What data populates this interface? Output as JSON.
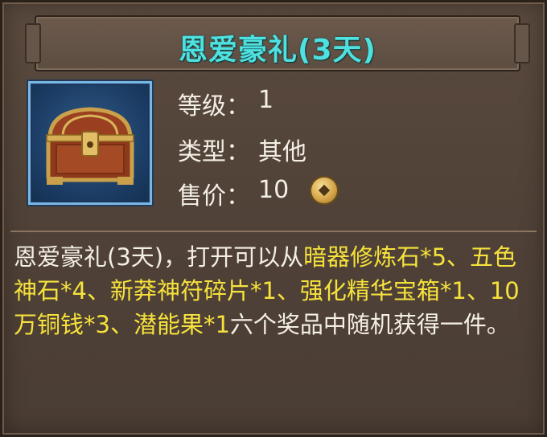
{
  "item": {
    "title": "恩爱豪礼(3天)",
    "icon": "treasure-chest-icon",
    "level_label": "等级：",
    "level_value": "1",
    "type_label": "类型：",
    "type_value": "其他",
    "price_label": "售价：",
    "price_value": "10",
    "currency_icon": "copper-coin-icon"
  },
  "description": {
    "part1": "恩爱豪礼(3天)，打开可以从",
    "part2": "暗器修炼石*5、五色神石*4、新莽神符碎片*1、强化精华宝箱*1、10万铜钱*3、潜能果*1",
    "part3": "六个奖品中随机获得一件。"
  },
  "colors": {
    "title": "#4fe0e0",
    "highlight": "#f6e23c",
    "text": "#f4efe6",
    "panel": "#4f4137"
  }
}
